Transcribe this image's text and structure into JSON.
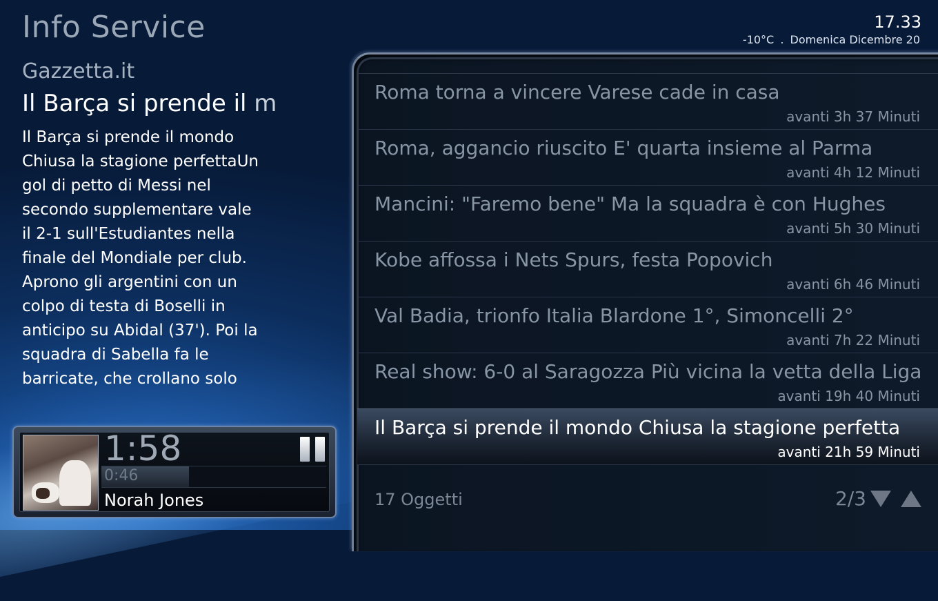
{
  "app": {
    "title": "Info Service"
  },
  "status": {
    "time": "17.33",
    "temperature": "-10°C",
    "separator": ".",
    "date": "Domenica Dicembre 20"
  },
  "article": {
    "source": "Gazzetta.it",
    "headline_main": "Il Barça si prende il ",
    "headline_fade": "m",
    "body": "Il Barça si prende il mondo Chiusa la stagione perfettaUn gol di petto di Messi nel secondo supplementare vale il 2-1 sull'Estudiantes nella finale del Mondiale per club. Aprono gli argentini con un colpo di testa di Boselli in anticipo su Abidal (37'). Poi la squadra di Sabella fa le barricate, che crollano solo"
  },
  "player": {
    "total_time": "1:58",
    "elapsed": "0:46",
    "progress": 0.39,
    "artist": "Norah Jones",
    "album_icon": "album-cover",
    "pause_icon": "pause-icon"
  },
  "news": {
    "items": [
      {
        "title": "Roma torna a vincere Varese cade in casa",
        "meta": "avanti 3h 37 Minuti"
      },
      {
        "title": "Roma, aggancio riuscito E' quarta insieme al Parma",
        "meta": "avanti 4h 12 Minuti"
      },
      {
        "title": "Mancini: \"Faremo bene\" Ma la squadra è con Hughes",
        "meta": "avanti 5h 30 Minuti"
      },
      {
        "title": "Kobe affossa i Nets Spurs, festa Popovich",
        "meta": "avanti 6h 46 Minuti"
      },
      {
        "title": "Val Badia, trionfo Italia Blardone 1°, Simoncelli 2°",
        "meta": "avanti 7h 22 Minuti"
      },
      {
        "title": "Real show: 6-0 al Saragozza Più vicina la vetta della Liga",
        "meta": "avanti 19h 40 Minuti"
      },
      {
        "title": "Il Barça si prende il mondo Chiusa la stagione perfetta",
        "meta": "avanti 21h 59 Minuti",
        "selected": true
      }
    ],
    "count_label": "17 Oggetti",
    "page_label": "2/3"
  },
  "colors": {
    "selected_text": "#ffffff",
    "item_text": "#8895a5",
    "accent": "#6f7e94"
  }
}
